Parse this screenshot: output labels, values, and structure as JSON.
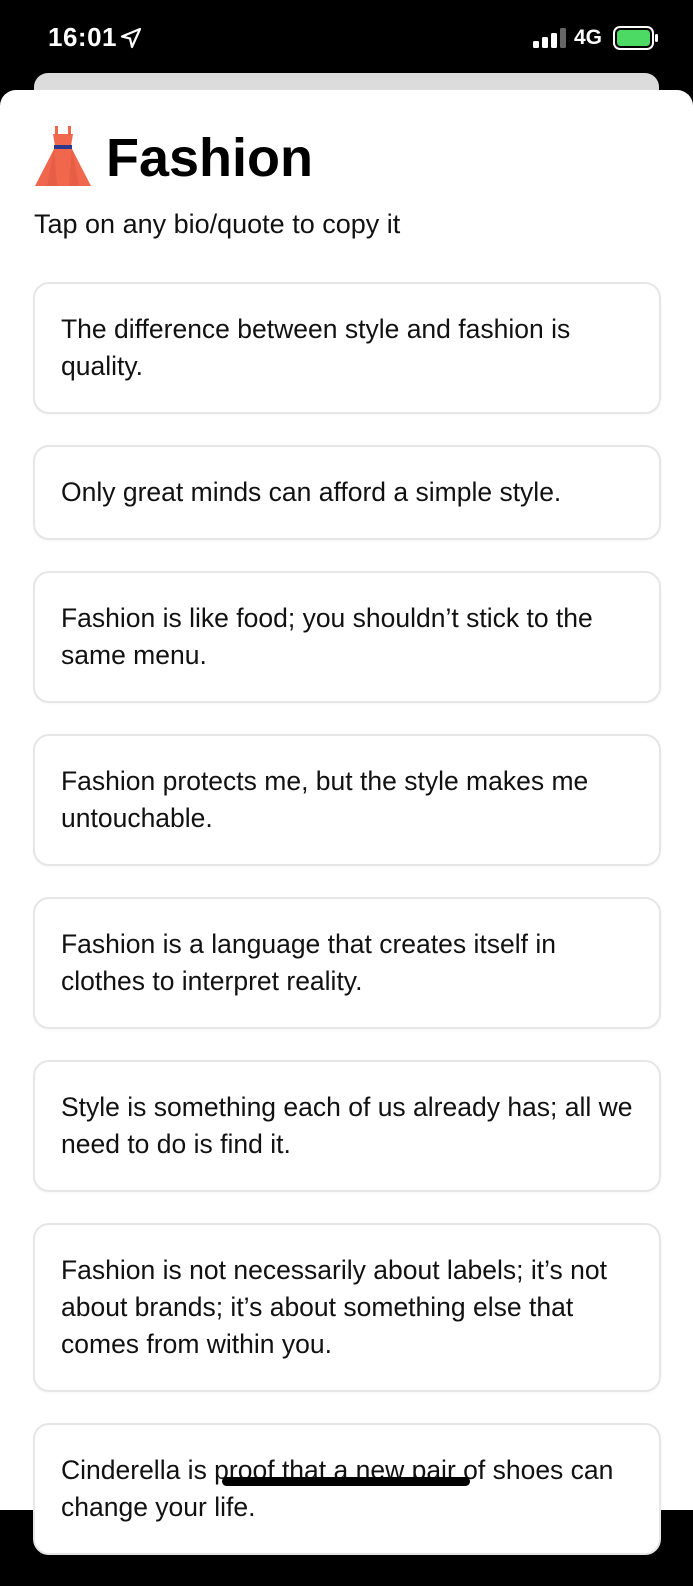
{
  "status_bar": {
    "time": "16:01",
    "network": "4G",
    "icons": [
      "location-arrow-icon",
      "signal-icon",
      "battery-icon"
    ]
  },
  "header": {
    "icon": "dress-icon",
    "title": "Fashion",
    "subtitle": "Tap on any bio/quote to copy it"
  },
  "quotes": [
    "The difference between style and fashion is quality.",
    "Only great minds can afford a simple style.",
    "Fashion is like food; you shouldn’t stick to the same menu.",
    "Fashion protects me, but the style makes me untouchable.",
    "Fashion is a language that creates itself in clothes to interpret reality.",
    "Style is something each of us already has; all we need to do is find it.",
    "Fashion is not necessarily about labels; it’s not about brands; it’s about something else that comes from within you.",
    "Cinderella is proof that a new pair of shoes can change your life."
  ],
  "colors": {
    "battery_green": "#4cd964",
    "dress_coral": "#f0674d",
    "dress_belt": "#2b3a8f",
    "card_border": "#e6e6e6"
  }
}
